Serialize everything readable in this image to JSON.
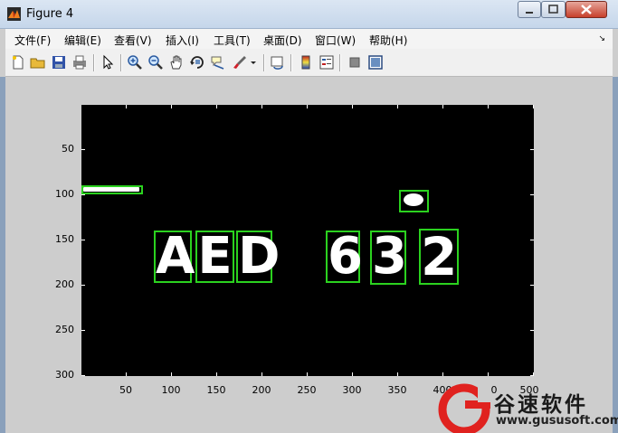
{
  "window": {
    "title": "Figure 4"
  },
  "menu": [
    "文件(F)",
    "编辑(E)",
    "查看(V)",
    "插入(I)",
    "工具(T)",
    "桌面(D)",
    "窗口(W)",
    "帮助(H)"
  ],
  "toolbar_icons": [
    "new-figure-icon",
    "open-file-icon",
    "save-icon",
    "print-icon",
    "pointer-icon",
    "zoom-in-icon",
    "zoom-out-icon",
    "pan-hand-icon",
    "rotate-3d-icon",
    "data-cursor-icon",
    "brush-icon",
    "link-plot-icon",
    "colorbar-icon",
    "legend-icon",
    "hide-plot-tools-icon",
    "show-plot-tools-icon"
  ],
  "axes": {
    "yticks": [
      "50",
      "100",
      "150",
      "200",
      "250",
      "300"
    ],
    "xticks": [
      "50",
      "100",
      "150",
      "200",
      "250",
      "300",
      "350",
      "400",
      "450",
      "500"
    ]
  },
  "plate_chars": [
    "A",
    "E",
    "D",
    "6",
    "3",
    "2"
  ],
  "watermark": {
    "name": "谷速软件",
    "url": "www.gususoft.com"
  }
}
